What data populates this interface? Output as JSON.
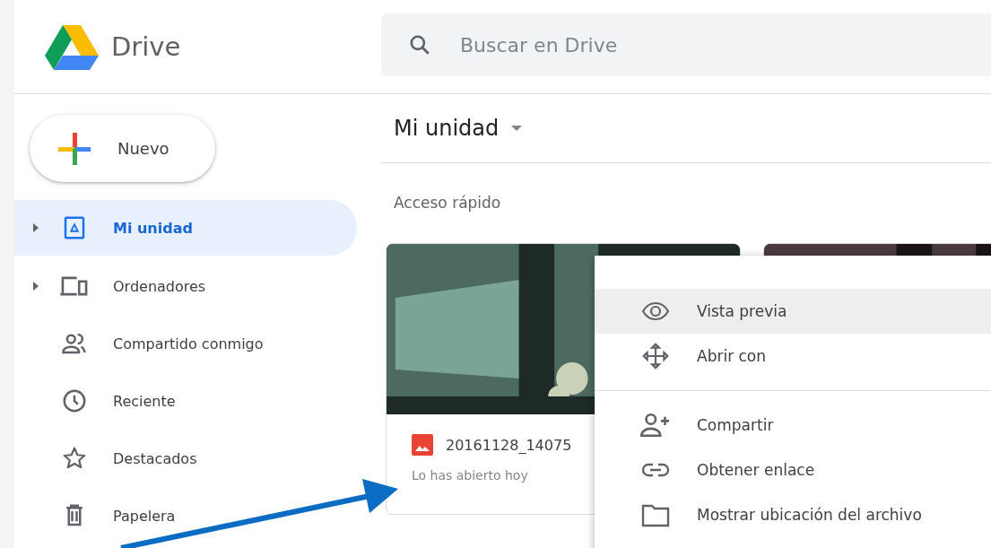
{
  "header": {
    "app_name": "Drive",
    "search": {
      "placeholder": "Buscar en Drive"
    }
  },
  "sidebar": {
    "new_button": "Nuevo",
    "items": [
      {
        "label": "Mi unidad",
        "kind": "drive",
        "expandable": true,
        "selected": true
      },
      {
        "label": "Ordenadores",
        "kind": "computers",
        "expandable": true,
        "selected": false
      },
      {
        "label": "Compartido conmigo",
        "kind": "shared",
        "expandable": false,
        "selected": false
      },
      {
        "label": "Reciente",
        "kind": "recent",
        "expandable": false,
        "selected": false
      },
      {
        "label": "Destacados",
        "kind": "starred",
        "expandable": false,
        "selected": false
      },
      {
        "label": "Papelera",
        "kind": "trash",
        "expandable": false,
        "selected": false
      }
    ]
  },
  "main": {
    "title": "Mi unidad",
    "section": "Acceso rápido",
    "cards": [
      {
        "kind": "picture",
        "name": "20161128_14075",
        "subtitle": "Lo has abierto hoy"
      },
      {
        "kind": "picture"
      }
    ]
  },
  "context_menu": {
    "groups": [
      [
        {
          "label": "Vista previa",
          "kind": "preview",
          "selected": true
        },
        {
          "label": "Abrir con",
          "kind": "open",
          "selected": false
        }
      ],
      [
        {
          "label": "Compartir",
          "kind": "share",
          "selected": false
        },
        {
          "label": "Obtener enlace",
          "kind": "link",
          "selected": false
        },
        {
          "label": "Mostrar ubicación del archivo",
          "kind": "location",
          "selected": false
        }
      ]
    ]
  }
}
